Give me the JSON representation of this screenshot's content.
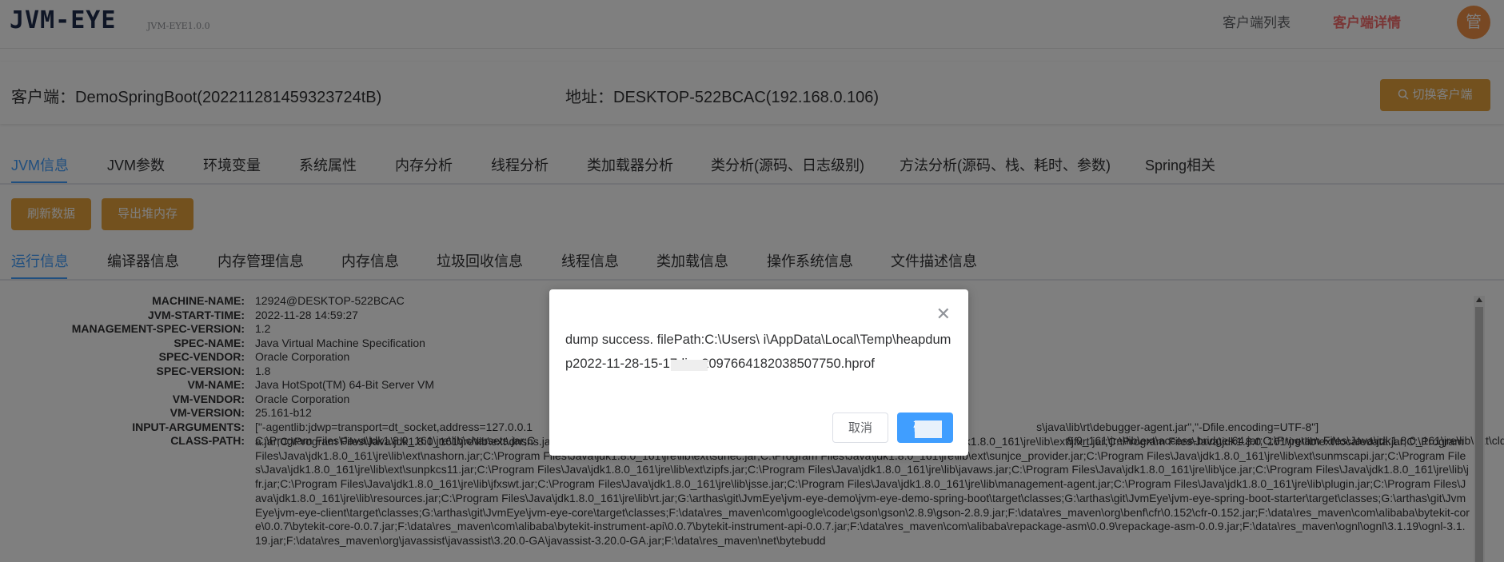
{
  "header": {
    "logo": "JVM-EYE",
    "version": "JVM-EYE1.0.0",
    "nav": [
      "客户端列表",
      "客户端详情"
    ],
    "avatar": "管"
  },
  "client": {
    "client_label": "客户端：DemoSpringBoot(20221128145932372​4tB)",
    "address_label": "地址：DESKTOP-522BCAC(192.168.0.106)",
    "switch_button": "切换客户端"
  },
  "main_tabs": [
    "JVM信息",
    "JVM参数",
    "环境变量",
    "系统属性",
    "内存分析",
    "线程分析",
    "类加载器分析",
    "类分析(源码、日志级别)",
    "方法分析(源码、栈、耗时、参数)",
    "Spring相关"
  ],
  "actions": {
    "refresh": "刷新数据",
    "export_heap": "导出堆内存"
  },
  "sub_tabs": [
    "运行信息",
    "编译器信息",
    "内存管理信息",
    "内存信息",
    "垃圾回收信息",
    "线程信息",
    "类加载信息",
    "操作系统信息",
    "文件描述信息"
  ],
  "info": [
    {
      "key": "MACHINE-NAME:",
      "value": "12924@DESKTOP-522BCAC"
    },
    {
      "key": "JVM-START-TIME:",
      "value": "2022-11-28 14:59:27"
    },
    {
      "key": "MANAGEMENT-SPEC-VERSION:",
      "value": "1.2"
    },
    {
      "key": "SPEC-NAME:",
      "value": "Java Virtual Machine Specification"
    },
    {
      "key": "SPEC-VENDOR:",
      "value": "Oracle Corporation"
    },
    {
      "key": "SPEC-VERSION:",
      "value": "1.8"
    },
    {
      "key": "VM-NAME:",
      "value": "Java HotSpot(TM) 64-Bit Server VM"
    },
    {
      "key": "VM-VENDOR:",
      "value": "Oracle Corporation"
    },
    {
      "key": "VM-VERSION:",
      "value": "25.161-b12"
    },
    {
      "key": "INPUT-ARGUMENTS:",
      "value": "[\"-agentlib:jdwp=transport=dt_socket,address=127.0.0.1                                                                                                                                                                  s\\java\\lib\\rt\\debugger-agent.jar\",\"-Dfile.encoding=UTF-8\"]"
    },
    {
      "key": "CLASS-PATH:",
      "value": "C:\\Program Files\\Java\\jdk1.8.0_161\\jre\\lib\\charsets.jar;C"
    }
  ],
  "classpath_first_tail": "                                                                                                                                                                           8.0_161\\jre\\lib\\ext\\access-bridge-64.jar;C:\\Program Files\\Java\\jdk1.8.0_161\\jre\\lib\\ext\\cldrdat",
  "classpath": "a.jar;C:\\Program Files\\Java\\jdk1.8.0_161\\jre\\lib\\ext\\dnsns.jar;C:\\Program Files\\Java\\jdk1.8.0_161\\jre\\lib\\ext\\jaccess.jar;C:\\Program Files\\Java\\jdk1.8.0_161\\jre\\lib\\ext\\jfxrt.jar;C:\\Program Files\\Java\\jdk1.8.0_161\\jre\\lib\\ext\\localedata.jar;C:\\Program Files\\Java\\jdk1.8.0_161\\jre\\lib\\ext\\nashorn.jar;C:\\Program Files\\Java\\jdk1.8.0_161\\jre\\lib\\ext\\sunec.jar;C:\\Program Files\\Java\\jdk1.8.0_161\\jre\\lib\\ext\\sunjce_provider.jar;C:\\Program Files\\Java\\jdk1.8.0_161\\jre\\lib\\ext\\sunmscapi.jar;C:\\Program Files\\Java\\jdk1.8.0_161\\jre\\lib\\ext\\sunpkcs11.jar;C:\\Program Files\\Java\\jdk1.8.0_161\\jre\\lib\\ext\\zipfs.jar;C:\\Program Files\\Java\\jdk1.8.0_161\\jre\\lib\\javaws.jar;C:\\Program Files\\Java\\jdk1.8.0_161\\jre\\lib\\jce.jar;C:\\Program Files\\Java\\jdk1.8.0_161\\jre\\lib\\jfr.jar;C:\\Program Files\\Java\\jdk1.8.0_161\\jre\\lib\\jfxswt.jar;C:\\Program Files\\Java\\jdk1.8.0_161\\jre\\lib\\jsse.jar;C:\\Program Files\\Java\\jdk1.8.0_161\\jre\\lib\\management-agent.jar;C:\\Program Files\\Java\\jdk1.8.0_161\\jre\\lib\\plugin.jar;C:\\Program Files\\Java\\jdk1.8.0_161\\jre\\lib\\resources.jar;C:\\Program Files\\Java\\jdk1.8.0_161\\jre\\lib\\rt.jar;G:\\arthas\\git\\JvmEye\\jvm-eye-demo\\jvm-eye-demo-spring-boot\\target\\classes;G:\\arthas\\git\\JvmEye\\jvm-eye-spring-boot-starter\\target\\classes;G:\\arthas\\git\\JvmEye\\jvm-eye-client\\target\\classes;G:\\arthas\\git\\JvmEye\\jvm-eye-core\\target\\classes;F:\\data\\res_maven\\com\\google\\code\\gson\\gson\\2.8.9\\gson-2.8.9.jar;F:\\data\\res_maven\\org\\benf\\cfr\\0.152\\cfr-0.152.jar;F:\\data\\res_maven\\com\\alibaba\\bytekit-core\\0.0.7\\bytekit-core-0.0.7.jar;F:\\data\\res_maven\\com\\alibaba\\bytekit-instrument-api\\0.0.7\\bytekit-instrument-api-0.0.7.jar;F:\\data\\res_maven\\com\\alibaba\\repackage-asm\\0.0.9\\repackage-asm-0.0.9.jar;F:\\data\\res_maven\\ognl\\ognl\\3.1.19\\ognl-3.1.19.jar;F:\\data\\res_maven\\org\\javassist\\javassist\\3.20.0-GA\\javassist-3.20.0-GA.jar;F:\\data\\res_maven\\net\\bytebudd",
  "dialog": {
    "message": "dump success. filePath:C:\\Users\\       i\\AppData\\Local\\Temp\\heapdump2022-11-28-15-17-live2097664182038507750.hprof",
    "cancel": "取消",
    "ok": "确定"
  },
  "colors": {
    "primary": "#409eff",
    "warning": "#e6a23c",
    "danger": "#f56c6c"
  }
}
